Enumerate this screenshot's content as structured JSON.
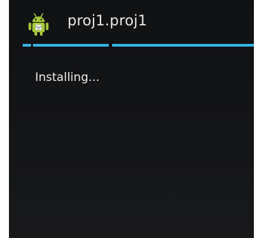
{
  "window": {
    "title": "proj1.proj1",
    "icon": "android-robot-icon"
  },
  "progress": {
    "state": "indeterminate",
    "color": "#33b5e5"
  },
  "content": {
    "status_text": "Installing..."
  }
}
